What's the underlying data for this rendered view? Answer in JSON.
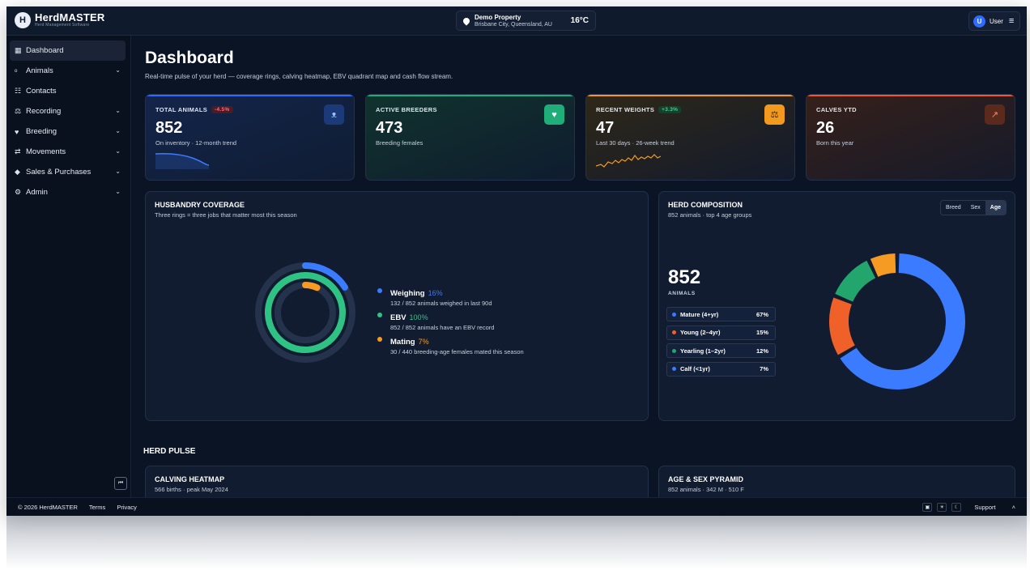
{
  "app": {
    "logo_text": "HerdMASTER",
    "logo_sub": "Herd Management Software"
  },
  "location": {
    "name": "Demo Property",
    "address": "Brisbane City, Queensland, AU",
    "temp": "16°C"
  },
  "user": {
    "initial": "U",
    "name": "User"
  },
  "sidebar": {
    "items": [
      {
        "label": "Dashboard",
        "icon": "dashboard-icon"
      },
      {
        "label": "Animals",
        "icon": "animals-icon",
        "chevron": true
      },
      {
        "label": "Contacts",
        "icon": "contacts-icon"
      },
      {
        "label": "Recording",
        "icon": "scale-icon",
        "chevron": true
      },
      {
        "label": "Breeding",
        "icon": "heart-icon",
        "chevron": true
      },
      {
        "label": "Movements",
        "icon": "arrows-icon",
        "chevron": true
      },
      {
        "label": "Sales & Purchases",
        "icon": "tag-icon",
        "chevron": true
      },
      {
        "label": "Admin",
        "icon": "admin-icon",
        "chevron": true
      }
    ]
  },
  "page": {
    "title": "Dashboard",
    "subtitle": "Real-time pulse of your herd — coverage rings, calving heatmap, EBV quadrant map and cash flow stream."
  },
  "kpis": [
    {
      "label": "TOTAL ANIMALS",
      "trend": "-4.5%",
      "value": "852",
      "sub": "On inventory · 12-month trend",
      "color": "#2f6bff"
    },
    {
      "label": "ACTIVE BREEDERS",
      "trend": "",
      "value": "473",
      "sub": "Breeding females",
      "color": "#1fae7a"
    },
    {
      "label": "RECENT WEIGHTS",
      "trend": "+3.3%",
      "value": "47",
      "sub": "Last 30 days · 26-week trend",
      "color": "#f39a1e"
    },
    {
      "label": "CALVES YTD",
      "trend": "",
      "value": "26",
      "sub": "Born this year",
      "color": "#f05a28"
    }
  ],
  "coverage": {
    "title": "HUSBANDRY COVERAGE",
    "subtitle": "Three rings = three jobs that matter most this season",
    "rings": [
      {
        "name": "Weighing",
        "pct": "16%",
        "value": 0.16,
        "desc": "132 / 852 animals weighed in last 90d",
        "color": "#3b7bff"
      },
      {
        "name": "EBV",
        "pct": "100%",
        "value": 1.0,
        "desc": "852 / 852 animals have an EBV record",
        "color": "#2ec385"
      },
      {
        "name": "Mating",
        "pct": "7%",
        "value": 0.07,
        "desc": "30 / 440 breeding-age females mated this season",
        "color": "#f59a23"
      }
    ]
  },
  "composition": {
    "title": "HERD COMPOSITION",
    "subtitle": "852 animals · top 4 age groups",
    "tabs": [
      "Breed",
      "Sex",
      "Age"
    ],
    "active_tab": "Age",
    "total": "852",
    "total_label": "ANIMALS",
    "groups": [
      {
        "label": "Mature (4+yr)",
        "pct": "67%",
        "value": 67,
        "color": "#3b7bff"
      },
      {
        "label": "Young (2–4yr)",
        "pct": "15%",
        "value": 15,
        "color": "#f0612a"
      },
      {
        "label": "Yearling (1–2yr)",
        "pct": "12%",
        "value": 12,
        "color": "#22a66e"
      },
      {
        "label": "Calf (<1yr)",
        "pct": "7%",
        "value": 7,
        "color": "#f59a23"
      }
    ]
  },
  "pulse": {
    "title": "HERD PULSE",
    "calving": {
      "title": "CALVING HEATMAP",
      "subtitle": "566 births · peak May 2024"
    },
    "pyramid": {
      "title": "AGE & SEX PYRAMID",
      "subtitle": "852 animals · 342 M · 510 F"
    }
  },
  "footer": {
    "copyright": "© 2026 HerdMASTER",
    "terms": "Terms",
    "privacy": "Privacy",
    "support": "Support"
  }
}
